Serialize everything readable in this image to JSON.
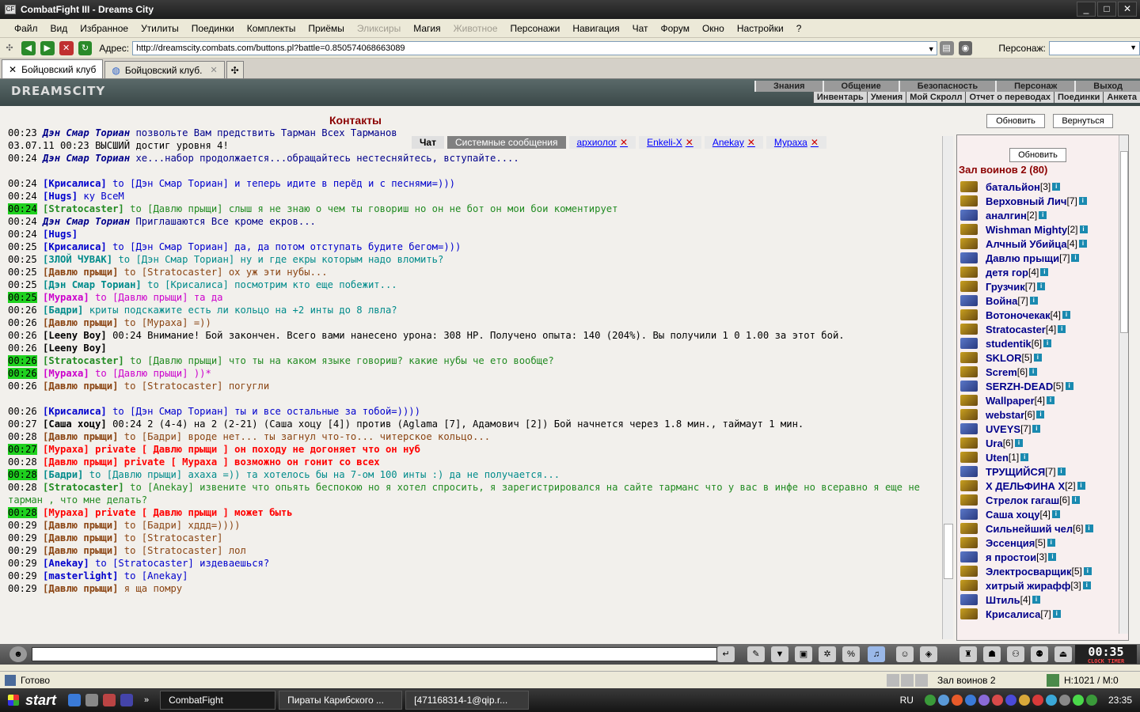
{
  "window": {
    "title": "CombatFight III - Dreams City"
  },
  "menu": [
    "Файл",
    "Вид",
    "Избранное",
    "Утилиты",
    "Поединки",
    "Комплекты",
    "Приёмы",
    "Эликсиры",
    "Магия",
    "Животное",
    "Персонажи",
    "Навигация",
    "Чат",
    "Форум",
    "Окно",
    "Настройки",
    "?"
  ],
  "menu_disabled": [
    "Эликсиры",
    "Животное"
  ],
  "address": {
    "label": "Адрес:",
    "url": "http://dreamscity.combats.com/buttons.pl?battle=0.850574068663089",
    "persona_label": "Персонаж:"
  },
  "tabs": [
    {
      "label": "Бойцовский клуб"
    },
    {
      "label": "Бойцовский клуб."
    }
  ],
  "site": {
    "logo": "DREAMSCITY",
    "nav_top": [
      "Знания",
      "Общение",
      "Безопасность",
      "Персонаж",
      "Выход"
    ],
    "nav_bottom": [
      "Инвентарь",
      "Умения",
      "Мой Скролл",
      "Отчет о переводах",
      "Поединки",
      "Анкета"
    ]
  },
  "contacts": {
    "title": "Контакты",
    "refresh": "Обновить",
    "back": "Вернуться"
  },
  "chat_tabs": [
    {
      "label": "Чат",
      "kind": "active"
    },
    {
      "label": "Системные сообщения",
      "kind": "sys"
    },
    {
      "label": "архиолог",
      "kind": "user"
    },
    {
      "label": "Enkeli-X",
      "kind": "user"
    },
    {
      "label": "Anekay",
      "kind": "user"
    },
    {
      "label": "Мураха",
      "kind": "user"
    }
  ],
  "chat_log": [
    {
      "t": "00:23",
      "hl": false,
      "name": "Дэн Смар Ториан",
      "text": "позвольте Вам предствить Тарман Всех Тарманов",
      "color": "#00008b",
      "style": "italic"
    },
    {
      "t": "03.07.11 00:23",
      "hl": false,
      "name": "",
      "text": "ВЫСШИЙ достиг уровня 4!",
      "color": "#000"
    },
    {
      "t": "00:24",
      "hl": false,
      "name": "Дэн Смар Ториан",
      "text": "хе...набор продолжается...обращайтесь нестесняйтесь, вступайте....",
      "color": "#00008b",
      "style": "italic"
    },
    {
      "t": "",
      "hl": false,
      "name": "",
      "text": "",
      "color": "#000"
    },
    {
      "t": "00:24",
      "hl": false,
      "name": "[Крисалиса]",
      "text": "to [Дэн Смар Ториан] и теперь идите в перёд и с песнями=)))",
      "color": "#0000cd"
    },
    {
      "t": "00:24",
      "hl": false,
      "name": "[Hugs]",
      "text": "ку ВсеМ",
      "color": "#0000cd"
    },
    {
      "t": "00:24",
      "hl": true,
      "name": "[Stratocaster]",
      "text": "to [Давлю прыщи] слыш я не знаю о чем ты говориш но он не бот он мои бои коментирует",
      "color": "#228b22"
    },
    {
      "t": "00:24",
      "hl": false,
      "name": "Дэн Смар Ториан",
      "text": "Приглашаются Все кроме екров...",
      "color": "#00008b",
      "style": "italic"
    },
    {
      "t": "00:24",
      "hl": false,
      "name": "[Hugs]",
      "text": "",
      "color": "#0000cd"
    },
    {
      "t": "00:25",
      "hl": false,
      "name": "[Крисалиса]",
      "text": "to [Дэн Смар Ториан] да, да потом отступать будите бегом=)))",
      "color": "#0000cd"
    },
    {
      "t": "00:25",
      "hl": false,
      "name": "[ЗЛОЙ ЧУВАК]",
      "text": "to [Дэн Смар Ториан] ну и где екры которым надо вломить?",
      "color": "#008b8b"
    },
    {
      "t": "00:25",
      "hl": false,
      "name": "[Давлю прыщи]",
      "text": "to [Stratocaster] ох уж эти нубы...",
      "color": "#8b4513"
    },
    {
      "t": "00:25",
      "hl": false,
      "name": "[Дэн Смар Ториан]",
      "text": "to [Крисалиса] посмотрим кто еще побежит...",
      "color": "#008b8b"
    },
    {
      "t": "00:25",
      "hl": true,
      "name": "[Мураха]",
      "text": "to [Давлю прыщи] та да",
      "color": "#cc00cc"
    },
    {
      "t": "00:26",
      "hl": false,
      "name": "[Бадри]",
      "text": "криты подскажите есть ли кольцо на +2 инты до 8 лвла?",
      "color": "#008b8b"
    },
    {
      "t": "00:26",
      "hl": false,
      "name": "[Давлю прыщи]",
      "text": "to [Мураха] =))",
      "color": "#8b4513"
    },
    {
      "t": "00:26",
      "hl": false,
      "name": "[Leeny Boy]",
      "text": "00:24 Внимание! Бой закончен. Всего вами нанесено урона: 308 HP. Получено опыта: 140 (204%). Вы получили 1 0 1.00 за этот бой.",
      "color": "#000"
    },
    {
      "t": "00:26",
      "hl": false,
      "name": "[Leeny Boy]",
      "text": "",
      "color": "#000"
    },
    {
      "t": "00:26",
      "hl": true,
      "name": "[Stratocaster]",
      "text": "to [Давлю прыщи] что ты на каком языке говориш? какие нубы че ето вообще?",
      "color": "#228b22"
    },
    {
      "t": "00:26",
      "hl": true,
      "name": "[Мураха]",
      "text": "to [Давлю прыщи] ))*",
      "color": "#cc00cc"
    },
    {
      "t": "00:26",
      "hl": false,
      "name": "[Давлю прыщи]",
      "text": "to [Stratocaster] погугли",
      "color": "#8b4513"
    },
    {
      "t": "",
      "hl": false,
      "name": "",
      "text": "",
      "color": "#000"
    },
    {
      "t": "00:26",
      "hl": false,
      "name": "[Крисалиса]",
      "text": "to [Дэн Смар Ториан]        ты и все остальные за тобой=))))",
      "color": "#0000cd"
    },
    {
      "t": "00:27",
      "hl": false,
      "name": "[Саша хоцу]",
      "text": "00:24 2 (4-4) на 2 (2-21) (Саша хоцу [4]) против (Aglama [7], Адамович [2]) Бой начнется через 1.8 мин., таймаут 1 мин.",
      "color": "#000"
    },
    {
      "t": "00:28",
      "hl": false,
      "name": "[Давлю прыщи]",
      "text": "to [Бадри] вроде нет... ты загнул что-то... читерское кольцо...",
      "color": "#8b4513"
    },
    {
      "t": "00:27",
      "hl": true,
      "name": "[Мураха]",
      "text": "private [ Давлю прыщи ] он походу не догоняет что он нуб",
      "color": "#ff0000"
    },
    {
      "t": "00:28",
      "hl": false,
      "name": "[Давлю прыщи]",
      "text": "private [ Мураха ] возможно он гонит со всех",
      "color": "#ff0000"
    },
    {
      "t": "00:28",
      "hl": true,
      "name": "[Бадри]",
      "text": "to [Давлю прыщи] ахаха =)) та хотелось бы на 7-ом 100 инты :) да не получается...",
      "color": "#008b8b"
    },
    {
      "t": "00:28",
      "hl": false,
      "name": "[Stratocaster]",
      "text": "to [Anekay] извените что опьять беспокою но я хотел спросить, я зарегистрировался на сайте тарманс что у вас в инфе но всеравно я еще не",
      "color": "#228b22"
    },
    {
      "t": "",
      "hl": false,
      "name": "",
      "text": "тарман , что мне делать?",
      "color": "#228b22"
    },
    {
      "t": "00:28",
      "hl": true,
      "name": "[Мураха]",
      "text": "private [ Давлю прыщи ] может быть",
      "color": "#ff0000"
    },
    {
      "t": "00:29",
      "hl": false,
      "name": "[Давлю прыщи]",
      "text": "to [Бадри] хддд=))))",
      "color": "#8b4513"
    },
    {
      "t": "00:29",
      "hl": false,
      "name": "[Давлю прыщи]",
      "text": "to [Stratocaster]",
      "color": "#8b4513"
    },
    {
      "t": "00:29",
      "hl": false,
      "name": "[Давлю прыщи]",
      "text": "to [Stratocaster] лол",
      "color": "#8b4513"
    },
    {
      "t": "00:29",
      "hl": false,
      "name": "[Anekay]",
      "text": "to [Stratocaster] издеваешься?",
      "color": "#0000cd"
    },
    {
      "t": "00:29",
      "hl": false,
      "name": "[masterlight]",
      "text": "to [Anekay]",
      "color": "#0000cd"
    },
    {
      "t": "00:29",
      "hl": false,
      "name": "[Давлю прыщи]",
      "text": "я ща помру",
      "color": "#8b4513"
    }
  ],
  "sidebar": {
    "refresh": "Обновить",
    "hall": "Зал воинов 2 (80)",
    "players": [
      {
        "name": "батальйон",
        "lvl": "[3]"
      },
      {
        "name": "Верховный Лич",
        "lvl": "[7]"
      },
      {
        "name": "аналгин",
        "lvl": "[2]"
      },
      {
        "name": "Wishman Mighty",
        "lvl": "[2]"
      },
      {
        "name": "Алчный Убийца",
        "lvl": "[4]"
      },
      {
        "name": "Давлю прыщи",
        "lvl": "[7]"
      },
      {
        "name": "детя гор",
        "lvl": "[4]"
      },
      {
        "name": "Грузчик",
        "lvl": "[7]"
      },
      {
        "name": "Война",
        "lvl": "[7]"
      },
      {
        "name": "Вотоночекак",
        "lvl": "[4]"
      },
      {
        "name": "Stratocaster",
        "lvl": "[4]"
      },
      {
        "name": "studentik",
        "lvl": "[6]"
      },
      {
        "name": "SKLOR",
        "lvl": "[5]"
      },
      {
        "name": "Screm",
        "lvl": "[6]"
      },
      {
        "name": "SERZH-DEAD",
        "lvl": "[5]"
      },
      {
        "name": "Wallpaper",
        "lvl": "[4]"
      },
      {
        "name": "webstar",
        "lvl": "[6]"
      },
      {
        "name": "UVEYS",
        "lvl": "[7]"
      },
      {
        "name": "Ura",
        "lvl": "[6]"
      },
      {
        "name": "Uten",
        "lvl": "[1]"
      },
      {
        "name": "ТРУЩИЙСЯ",
        "lvl": "[7]"
      },
      {
        "name": "Х ДЕЛЬФИНА Х",
        "lvl": "[2]"
      },
      {
        "name": "Стрелок гагаш",
        "lvl": "[6]"
      },
      {
        "name": "Саша хоцу",
        "lvl": "[4]"
      },
      {
        "name": "Сильнейший чел",
        "lvl": "[6]"
      },
      {
        "name": "Эссенция",
        "lvl": "[5]"
      },
      {
        "name": "я простои",
        "lvl": "[3]"
      },
      {
        "name": "Электросварщик",
        "lvl": "[5]"
      },
      {
        "name": "хитрый жирафф",
        "lvl": "[3]"
      },
      {
        "name": "Штиль",
        "lvl": "[4]"
      },
      {
        "name": "Крисалиса",
        "lvl": "[7]"
      }
    ]
  },
  "clock": {
    "time": "00:35",
    "sub": "CLOCK TIMER"
  },
  "status": {
    "text": "Готово",
    "location": "Зал воинов 2",
    "hm": "H:1021 / M:0"
  },
  "taskbar": {
    "start": "start",
    "tasks": [
      "CombatFight",
      "Пираты Карибского ...",
      "[471168314-1@qip.r..."
    ],
    "lang": "RU",
    "time": "23:35"
  }
}
